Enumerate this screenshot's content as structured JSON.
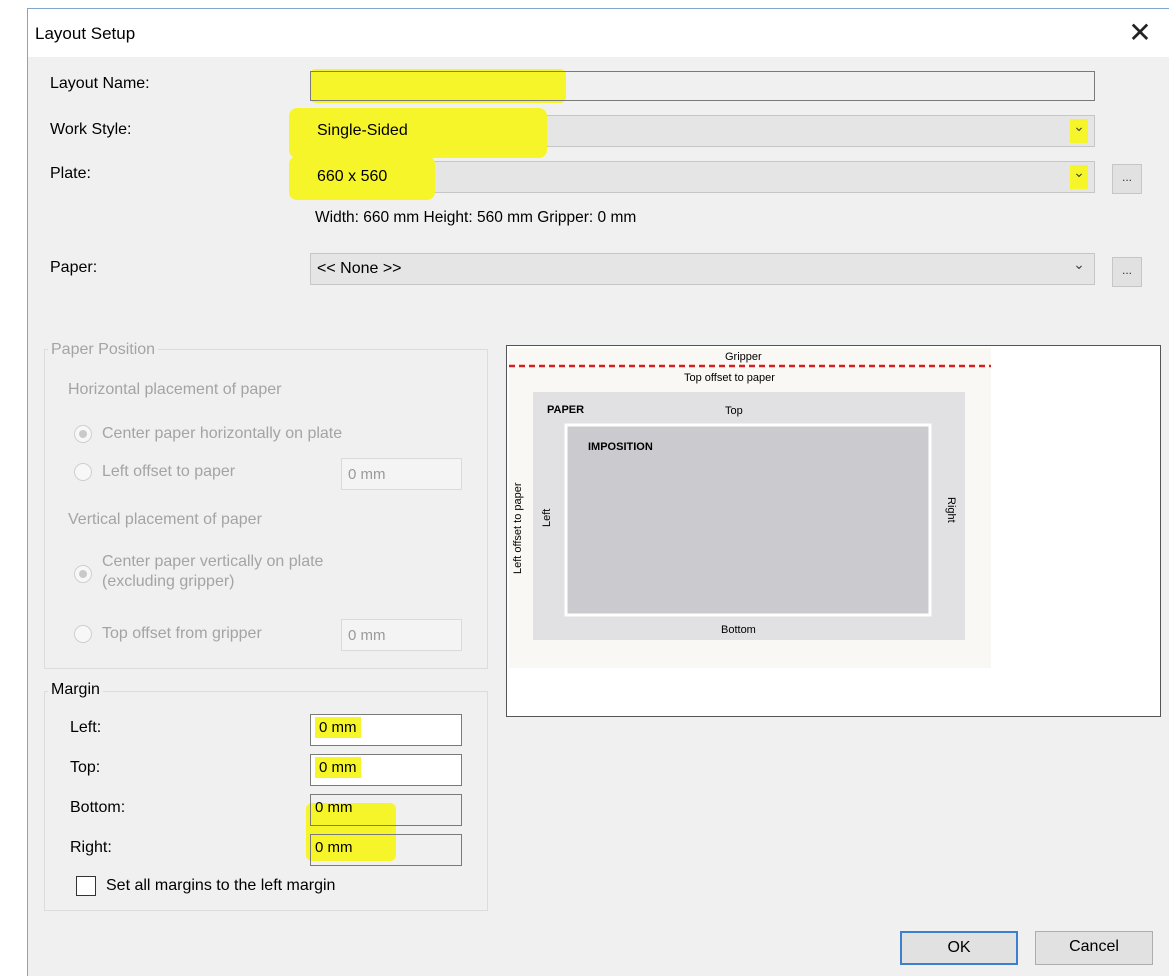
{
  "dialog": {
    "title": "Layout Setup",
    "close_symbol": "✕"
  },
  "form": {
    "layout_name_label": "Layout Name:",
    "layout_name_value": "",
    "work_style_label": "Work Style:",
    "work_style_value": "Single-Sided",
    "plate_label": "Plate:",
    "plate_value": "660 x 560",
    "plate_info": "Width: 660 mm   Height: 560 mm   Gripper: 0 mm",
    "paper_label": "Paper:",
    "paper_value": "<< None >>",
    "ellipsis": "..."
  },
  "paper_position": {
    "caption": "Paper Position",
    "horizontal_heading": "Horizontal placement of paper",
    "center_horizontal": "Center paper horizontally on plate",
    "left_offset_label": "Left offset to paper",
    "left_offset_value": "0 mm",
    "vertical_heading": "Vertical placement of paper",
    "center_vertical_line1": "Center paper vertically on plate",
    "center_vertical_line2": "(excluding gripper)",
    "top_offset_label": "Top offset from gripper",
    "top_offset_value": "0 mm"
  },
  "margin": {
    "caption": "Margin",
    "left_label": "Left:",
    "left_value": "0 mm",
    "top_label": "Top:",
    "top_value": "0 mm",
    "bottom_label": "Bottom:",
    "bottom_value": "0 mm",
    "right_label": "Right:",
    "right_value": "0 mm",
    "set_all_label": "Set all margins to the left margin"
  },
  "preview": {
    "gripper": "Gripper",
    "top_offset_to_paper": "Top offset to paper",
    "paper": "PAPER",
    "top": "Top",
    "imposition": "IMPOSITION",
    "left_offset_to_paper": "Left offset to paper",
    "left": "Left",
    "right": "Right",
    "bottom": "Bottom"
  },
  "buttons": {
    "ok": "OK",
    "cancel": "Cancel"
  },
  "colors": {
    "highlight": "#f6f52a",
    "gripper_line": "#d62020",
    "default_button_border": "#3c7fd1"
  }
}
